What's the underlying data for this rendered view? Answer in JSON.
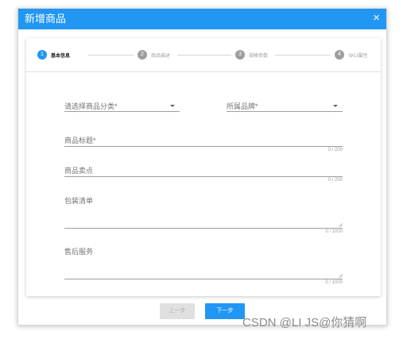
{
  "dialog": {
    "title": "新增商品",
    "close_glyph": "×",
    "close_icon": "close-icon"
  },
  "stepper": {
    "steps": [
      {
        "number": "1",
        "label": "基本信息",
        "active": true
      },
      {
        "number": "2",
        "label": "商品描述",
        "active": false
      },
      {
        "number": "3",
        "label": "规格参数",
        "active": false
      },
      {
        "number": "4",
        "label": "SKU属性",
        "active": false
      }
    ]
  },
  "form": {
    "category": {
      "label": "请选择商品分类*",
      "icon": "caret-down-icon"
    },
    "brand": {
      "label": "所属品牌*",
      "icon": "caret-down-icon"
    },
    "title": {
      "label": "商品标题*",
      "counter": "0 / 200"
    },
    "selling_point": {
      "label": "商品卖点",
      "counter": "0 / 200"
    },
    "package_list": {
      "label": "包装清单",
      "counter": "0 / 1000",
      "icon": "resize-handle-icon"
    },
    "after_sale": {
      "label": "售后服务",
      "counter": "0 / 1000",
      "icon": "resize-handle-icon"
    }
  },
  "footer": {
    "prev_label": "上一步",
    "next_label": "下一步"
  },
  "watermark": "CSDN @LI JS@你猜啊",
  "colors": {
    "primary": "#2196f3",
    "disabled_bg": "#e0e0e0",
    "step_inactive": "#9e9e9e"
  }
}
